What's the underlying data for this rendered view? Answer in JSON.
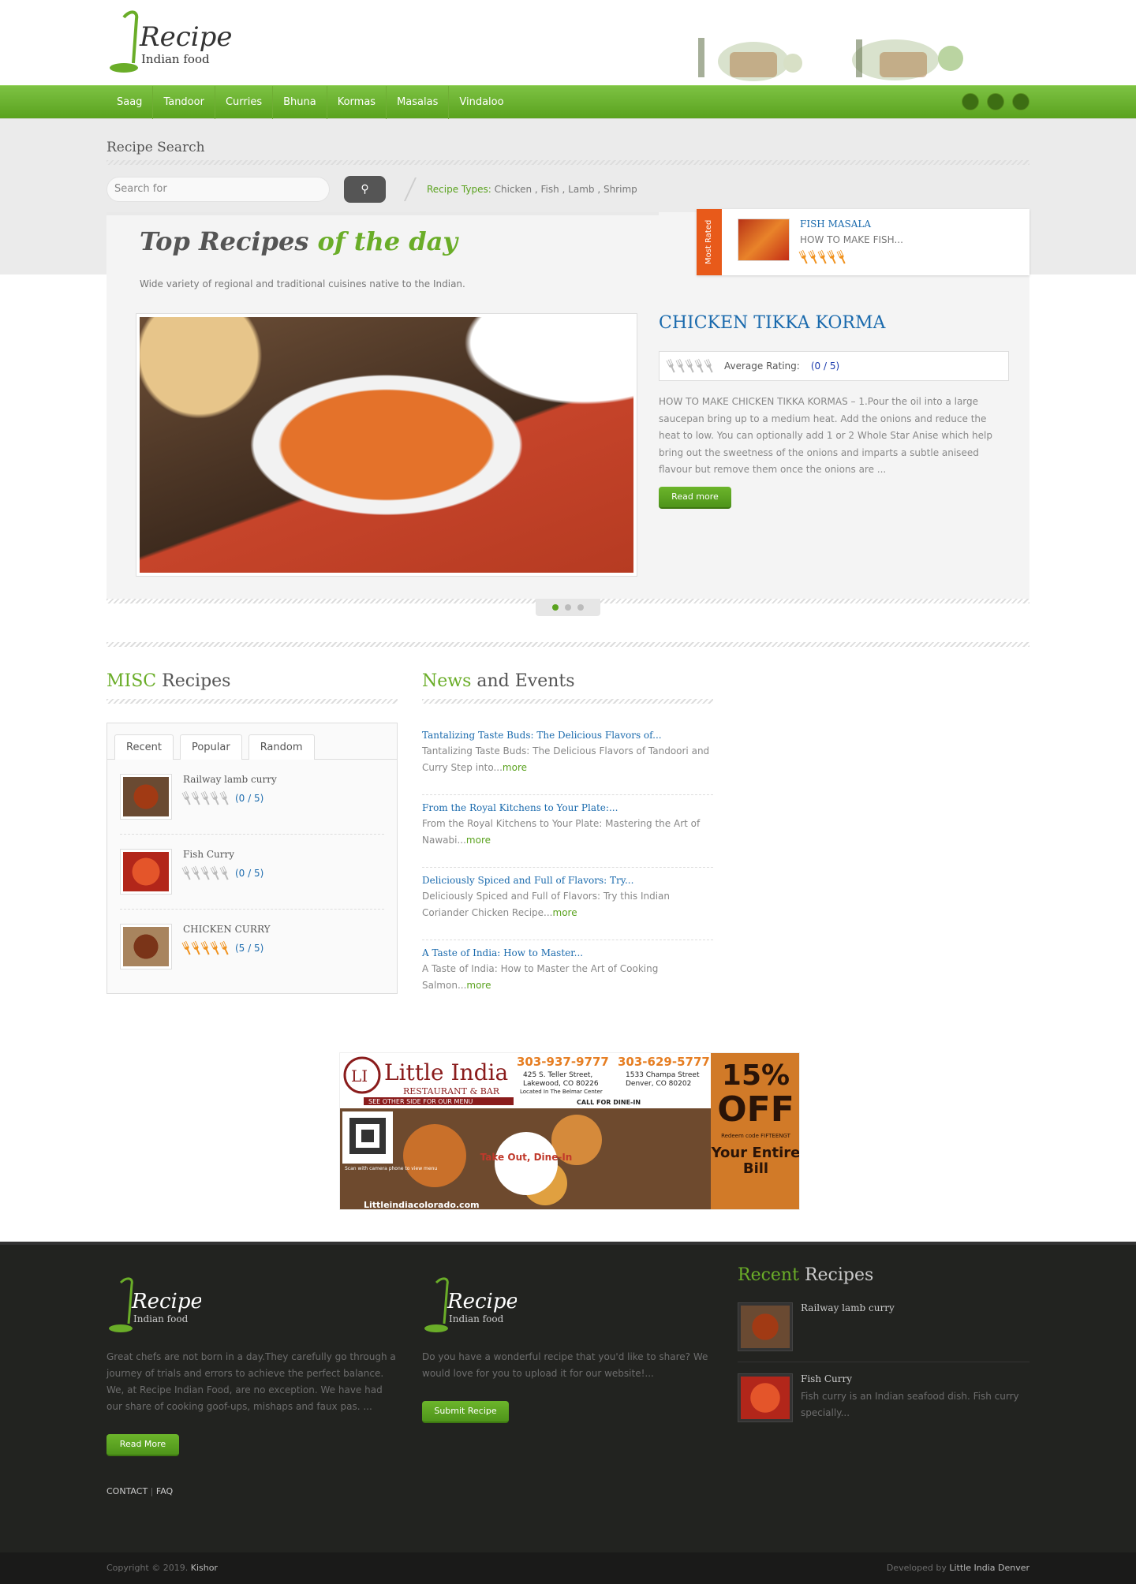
{
  "logo": {
    "title": "Recipe",
    "subtitle": "Indian food"
  },
  "nav": {
    "items": [
      "Saag",
      "Tandoor",
      "Curries",
      "Bhuna",
      "Kormas",
      "Masalas",
      "Vindaloo"
    ]
  },
  "search": {
    "title": "Recipe Search",
    "placeholder": "Search for",
    "button_icon": "search-icon",
    "types_label": "Recipe Types:",
    "types": "Chicken , Fish , Lamb , Shrimp"
  },
  "top": {
    "title_a": "Top Recipes",
    "title_b": "of the day",
    "subtitle": "Wide variety of regional and traditional cuisines native to the Indian."
  },
  "most_rated": {
    "ribbon": "Most Rated",
    "name": "FISH MASALA",
    "sub": "HOW TO MAKE FISH...",
    "rating": 5
  },
  "featured": {
    "title": "CHICKEN TIKKA KORMA",
    "rating_label": "Average Rating:",
    "rating_value": "(0 / 5)",
    "description": "HOW TO MAKE CHICKEN TIKKA KORMAS – 1.Pour the oil into a large saucepan bring up to a medium heat. Add the onions and reduce the heat to low. You can optionally add 1 or 2 Whole Star Anise which help bring out the sweetness of the onions and imparts a subtle aniseed flavour but remove them once the onions are ...",
    "read_more": "Read more"
  },
  "misc": {
    "title_a": "MISC",
    "title_b": "Recipes",
    "tabs": [
      "Recent",
      "Popular",
      "Random"
    ],
    "items": [
      {
        "name": "Railway lamb curry",
        "rating": "(0 / 5)"
      },
      {
        "name": "Fish Curry",
        "rating": "(0 / 5)"
      },
      {
        "name": "CHICKEN CURRY",
        "rating": "(5 / 5)"
      }
    ]
  },
  "news": {
    "title_a": "News",
    "title_b": "and Events",
    "items": [
      {
        "title": "Tantalizing Taste Buds: The Delicious Flavors of...",
        "desc": "Tantalizing Taste Buds: The Delicious Flavors of Tandoori and Curry Step into...",
        "more": "more"
      },
      {
        "title": "From the Royal Kitchens to Your Plate:...",
        "desc": "From the Royal Kitchens to Your Plate: Mastering the Art of Nawabi...",
        "more": "more"
      },
      {
        "title": "Deliciously Spiced and Full of Flavors: Try...",
        "desc": "Deliciously Spiced and Full of Flavors: Try this Indian Coriander Chicken Recipe...",
        "more": "more"
      },
      {
        "title": "A Taste of India: How to Master...",
        "desc": "A Taste of India: How to Master the Art of Cooking Salmon...",
        "more": "more"
      }
    ]
  },
  "ad": {
    "brand": "Little India",
    "brand_sub": "RESTAURANT & BAR",
    "phone1": "303-937-9777",
    "addr1a": "425 S. Teller Street,",
    "addr1b": "Lakewood, CO 80226",
    "addr1c": "Located In The Belmar Center",
    "phone2": "303-629-5777",
    "addr2a": "1533 Champa Street",
    "addr2b": "Denver, CO 80202",
    "other_side": "SEE OTHER SIDE FOR OUR MENU",
    "call": "CALL FOR DINE-IN",
    "takeout": "Take Out, Dine-In",
    "pct": "15%",
    "off": "OFF",
    "code": "Redeem code FIFTEENGT",
    "bill": "Your Entire Bill",
    "scan": "Scan with camera phone to view menu",
    "url": "Littleindiacolorado.com"
  },
  "footer": {
    "about": "Great chefs are not born in a day.They carefully go through a journey of trials and errors to achieve the perfect balance. We, at Recipe Indian Food, are no exception. We have had our share of cooking goof-ups, mishaps and faux pas. ...",
    "read_more": "Read More",
    "contact": "CONTACT",
    "faq": "FAQ",
    "share": "Do you have a wonderful recipe that you'd like to share? We would love for you to upload it for our website!...",
    "submit": "Submit Recipe",
    "recent_a": "Recent",
    "recent_b": "Recipes",
    "recent": [
      {
        "name": "Railway lamb curry",
        "desc": ""
      },
      {
        "name": "Fish Curry",
        "desc": "Fish curry is an Indian seafood dish. Fish curry specially..."
      }
    ],
    "copyright": "Copyright © 2019.",
    "author": "Kishor",
    "dev_label": "Developed by",
    "dev": "Little India Denver"
  },
  "colors": {
    "green": "#5aa21e",
    "blue": "#1a6aad",
    "orange": "#e85a1a",
    "dark": "#222320"
  }
}
